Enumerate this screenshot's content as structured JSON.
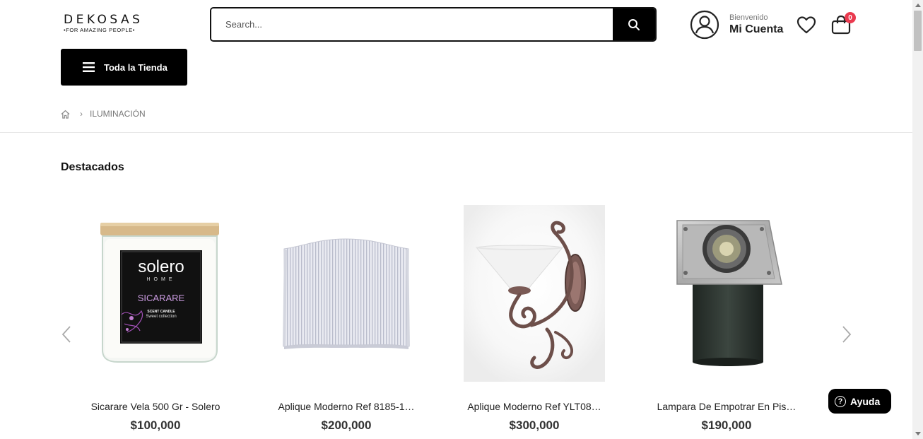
{
  "header": {
    "logo": {
      "name": "DEKOSAS",
      "tagline": "•FOR AMAZING PEOPLE•"
    },
    "search": {
      "placeholder": "Search..."
    },
    "account": {
      "welcome": "Bienvenido",
      "label": "Mi Cuenta"
    },
    "cart": {
      "count": "0"
    },
    "menu": {
      "label": "Toda la Tienda"
    }
  },
  "breadcrumb": {
    "current": "ILUMINACIÓN"
  },
  "section": {
    "title": "Destacados"
  },
  "products": [
    {
      "name": "Sicarare Vela 500 Gr - Solero",
      "price": "$100,000",
      "image": {
        "brand": "solero",
        "brand_sub": "HOME",
        "product": "SICARARE",
        "line1": "SCENT CANDLE",
        "line2": "Sweet collection"
      }
    },
    {
      "name": "Aplique Moderno Ref 8185-1…",
      "price": "$200,000"
    },
    {
      "name": "Aplique Moderno Ref YLT08…",
      "price": "$300,000"
    },
    {
      "name": "Lampara De Empotrar En Pis…",
      "price": "$190,000"
    }
  ],
  "help": {
    "label": "Ayuda",
    "icon": "?"
  },
  "colors": {
    "accent": "#000000",
    "badge": "#ea3a4f"
  }
}
